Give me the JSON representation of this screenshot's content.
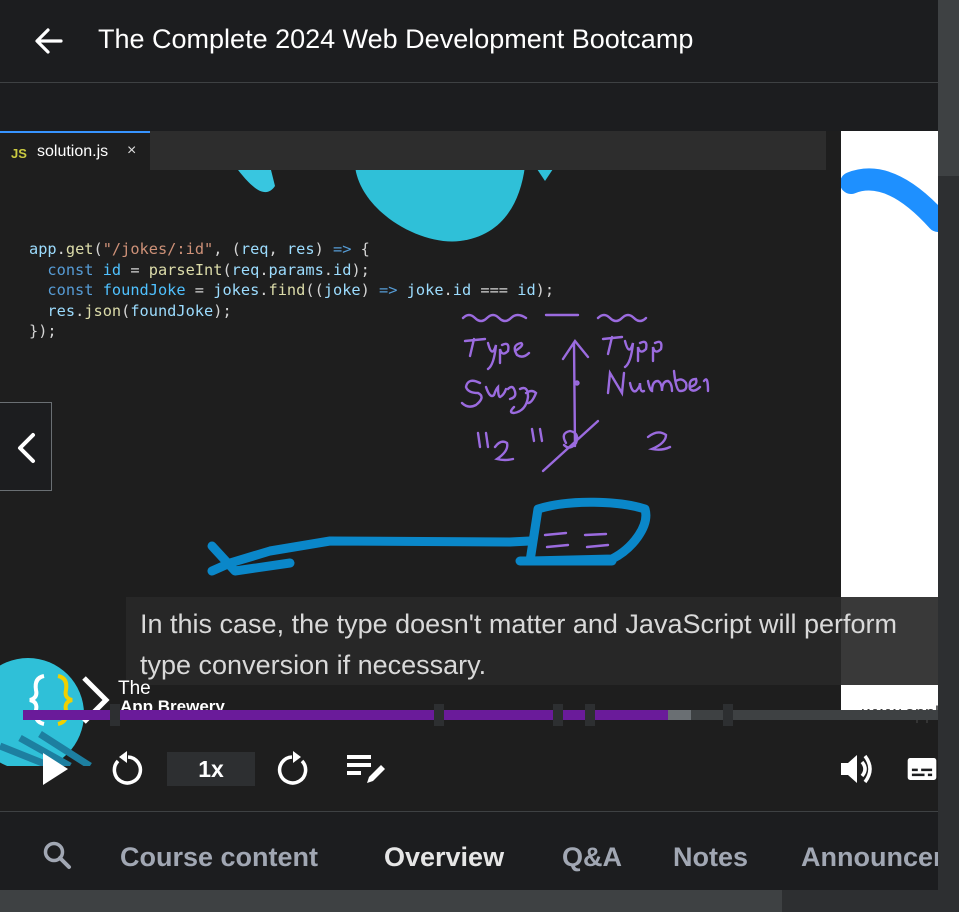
{
  "header": {
    "title": "The Complete 2024 Web Development Bootcamp",
    "back_icon": "arrow-left-icon"
  },
  "editor": {
    "tab_lang": "JS",
    "tab_file": "solution.js",
    "tab_close": "×",
    "code_lines": [
      "app.get(\"/jokes/:id\", (req, res) => {",
      "  const id = parseInt(req.params.id);",
      "  const foundJoke = jokes.find((joke) => joke.id === id);",
      "  res.json(foundJoke);",
      "});"
    ]
  },
  "caption": {
    "text": "In this case, the type doesn't matter and JavaScript will perform type conversion if necessary."
  },
  "brand": {
    "line1": "The",
    "line2": "App Brewery",
    "watermark": "www.appbrewery.com"
  },
  "player": {
    "speed": "1x",
    "progress_fraction": 0.705,
    "buffer_fraction": 0.73,
    "chapter_fractions": [
      0.1,
      0.455,
      0.585,
      0.62,
      0.77
    ],
    "colors": {
      "progress": "#6a1b9a",
      "buffer": "#6a6f73"
    }
  },
  "nav": {
    "tabs": [
      {
        "label": "Course content",
        "active": false
      },
      {
        "label": "Overview",
        "active": true
      },
      {
        "label": "Q&A",
        "active": false
      },
      {
        "label": "Notes",
        "active": false
      },
      {
        "label": "Announcements",
        "active": false
      }
    ]
  }
}
